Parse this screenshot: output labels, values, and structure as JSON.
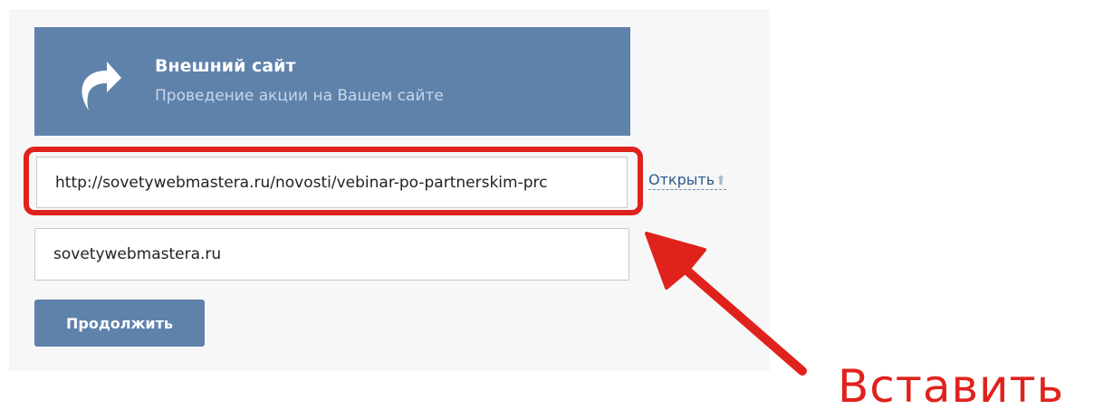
{
  "card": {
    "icon": "share-arrow-icon",
    "title": "Внешний сайт",
    "subtitle": "Проведение акции на Вашем сайте"
  },
  "form": {
    "url_value": "http://sovetywebmastera.ru/novosti/vebinar-po-partnerskim-prc",
    "domain_value": "sovetywebmastera.ru",
    "open_link_label": "Открыть",
    "open_link_icon": "arrow-up-icon",
    "continue_label": "Продолжить"
  },
  "annotation": {
    "label": "Вставить",
    "color": "#e0221d",
    "pointer_icon": "red-arrow-icon"
  },
  "colors": {
    "accent": "#5f82ab",
    "panel_bg": "#f7f7f7"
  }
}
